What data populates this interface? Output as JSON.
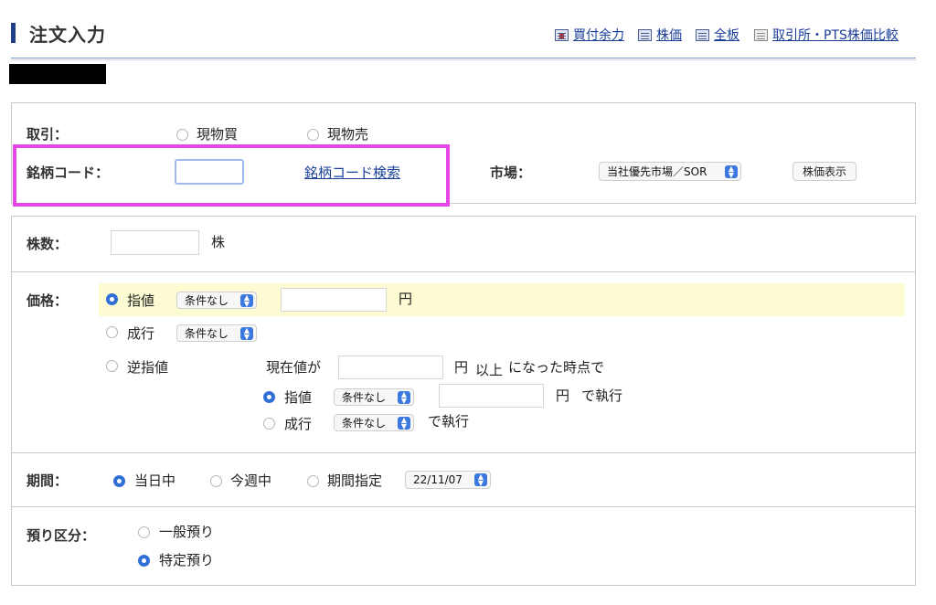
{
  "header": {
    "title": "注文入力",
    "links": [
      {
        "label": "買付余力",
        "icon": "buying-power-icon"
      },
      {
        "label": "株価",
        "icon": "stock-price-icon"
      },
      {
        "label": "全板",
        "icon": "full-board-icon"
      },
      {
        "label": "取引所・PTS株価比較",
        "icon": "exchange-compare-icon"
      }
    ]
  },
  "trade": {
    "label": "取引：",
    "options": [
      "現物買",
      "現物売"
    ]
  },
  "code": {
    "label": "銘柄コード：",
    "value": "",
    "search_link": "銘柄コード検索"
  },
  "market": {
    "label": "市場：",
    "selected": "当社優先市場／SOR",
    "button": "株価表示"
  },
  "shares": {
    "label": "株数：",
    "value": "",
    "unit": "株"
  },
  "price": {
    "label": "価格：",
    "limit_label": "指値",
    "limit_condition": "条件なし",
    "limit_value": "",
    "yen": "円",
    "market_label": "成行",
    "market_condition": "条件なし",
    "stop_label": "逆指値",
    "current_price_label": "現在値が",
    "stop_value": "",
    "above_label": "以上",
    "when_label": "になった時点で",
    "stop_limit_label": "指値",
    "stop_limit_condition": "条件なし",
    "stop_limit_value": "",
    "execute_label": "で執行",
    "stop_market_label": "成行",
    "stop_market_condition": "条件なし"
  },
  "period": {
    "label": "期間：",
    "options": [
      "当日中",
      "今週中",
      "期間指定"
    ],
    "date": "22/11/07"
  },
  "deposit": {
    "label": "預り区分：",
    "options": [
      "一般預り",
      "特定預り"
    ]
  },
  "colors": {
    "accent": "#2f6fd6",
    "link": "#1a3f9a",
    "highlight": "#e646e6",
    "limit_row": "#fdfbd2"
  }
}
